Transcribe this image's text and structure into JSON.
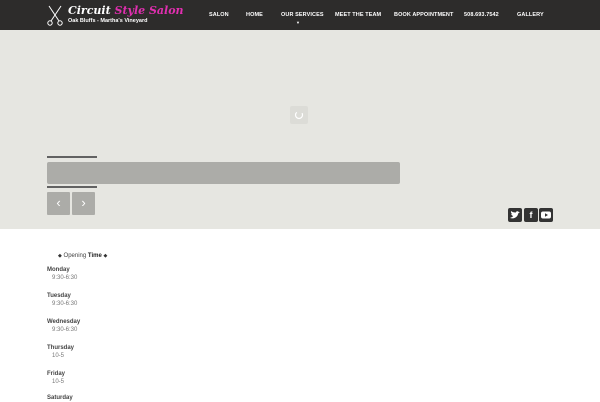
{
  "brand": {
    "name_part1": "Circuit",
    "name_part2": "Style Salon",
    "tagline": "Oak Bluffs - Martha's Vineyard",
    "accent_color": "#e12fb0"
  },
  "nav": {
    "items": [
      "SALON",
      "HOME",
      "OUR SERVICES",
      "MEET THE TEAM",
      "BOOK APPOINTMENT",
      "508.693.7542",
      "GALLERY"
    ],
    "dropdown_icon": "caret-down-icon"
  },
  "slider": {
    "prev_icon": "chevron-left-icon",
    "next_icon": "chevron-right-icon",
    "loading_icon": "loading-icon"
  },
  "social": {
    "twitter": "twitter-icon",
    "facebook": "facebook-icon",
    "youtube": "youtube-icon"
  },
  "hours": {
    "title_prefix": "Opening",
    "title_bold": "Time",
    "days": [
      {
        "day": "Monday",
        "time": "9:30-6:30"
      },
      {
        "day": "Tuesday",
        "time": "9:30-6:30"
      },
      {
        "day": "Wednesday",
        "time": "9:30-6:30"
      },
      {
        "day": "Thursday",
        "time": "10-5"
      },
      {
        "day": "Friday",
        "time": "10-5"
      },
      {
        "day": "Saturday",
        "time": ""
      }
    ]
  }
}
